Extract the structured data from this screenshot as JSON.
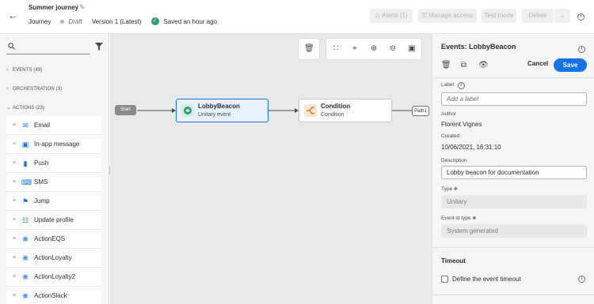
{
  "header": {
    "title": "Summer journey",
    "breadcrumb": "Journey",
    "status": "Draft",
    "version": "Version 1 (Latest)",
    "saved": "Saved an hour ago",
    "alerts_label": "Alerts (1)",
    "manage_access_label": "Manage access",
    "test_mode_label": "Test mode",
    "delete_label": "Delete"
  },
  "left": {
    "search_placeholder": "",
    "categories": [
      {
        "label": "EVENTS (49)",
        "expanded": false
      },
      {
        "label": "ORCHESTRATION (3)",
        "expanded": false
      },
      {
        "label": "ACTIONS (23)",
        "expanded": true
      }
    ],
    "actions": [
      {
        "label": "Email",
        "icon": "email-icon"
      },
      {
        "label": "In-app message",
        "icon": "in-app-message-icon"
      },
      {
        "label": "Push",
        "icon": "push-icon"
      },
      {
        "label": "SMS",
        "icon": "sms-icon"
      },
      {
        "label": "Jump",
        "icon": "jump-icon"
      },
      {
        "label": "Update profile",
        "icon": "update-profile-icon"
      },
      {
        "label": "ActionEQS",
        "icon": "custom-action-icon"
      },
      {
        "label": "ActionLoyalty",
        "icon": "custom-action-icon"
      },
      {
        "label": "ActionLoyalty2",
        "icon": "custom-action-icon"
      },
      {
        "label": "ActionSlack",
        "icon": "custom-action-icon"
      }
    ]
  },
  "canvas": {
    "start_label": "Start",
    "event_node": {
      "title": "LobbyBeacon",
      "subtitle": "Unitary event"
    },
    "condition_node": {
      "title": "Condition",
      "subtitle": "Condition"
    },
    "path_label": "Path1"
  },
  "panel": {
    "title": "Events: LobbyBeacon",
    "cancel_label": "Cancel",
    "save_label": "Save",
    "label_label": "Label",
    "label_placeholder": "Add a label",
    "author_label": "Author",
    "author_value": "Florent Vignes",
    "created_label": "Created",
    "created_value": "10/06/2021, 16:31:10",
    "description_label": "Description",
    "description_value": "Lobby beacon for documentation",
    "type_label": "Type",
    "type_value": "Unitary",
    "event_id_type_label": "Event id type",
    "event_id_type_value": "System generated",
    "timeout_title": "Timeout",
    "timeout_checkbox_label": "Define the event timeout"
  },
  "colors": {
    "accent": "#1473e6",
    "success": "#2d9d78",
    "selected_node_bg": "#e6f1fd",
    "event_icon_bg": "#2d9d78",
    "condition_icon_bg": "#e8761a"
  }
}
